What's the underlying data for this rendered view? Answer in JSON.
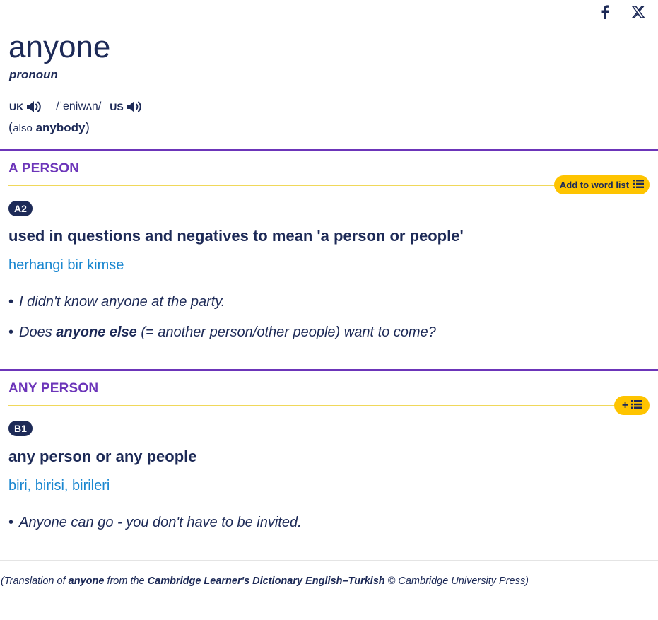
{
  "share": {
    "facebook_icon": "facebook-icon",
    "x_icon": "x-twitter-icon"
  },
  "entry": {
    "headword": "anyone",
    "pos": "pronoun",
    "uk_label": "UK",
    "us_label": "US",
    "ipa": "/ˈeniwʌn/",
    "also_open": "(",
    "also_label": "also",
    "also_word": "anybody",
    "also_close": ")"
  },
  "senses": [
    {
      "guideword": "A PERSON",
      "wordlist_label": "Add to word list",
      "level": "A2",
      "definition": "used in questions and negatives to mean 'a person or people'",
      "translation": "herhangi bir kimse",
      "examples": [
        {
          "bullet": "•",
          "text": "I didn't know anyone at the party."
        },
        {
          "bullet": "•",
          "pre": "Does",
          "bold": "anyone else",
          "post": "(= another person/other people) want to come?"
        }
      ]
    },
    {
      "guideword": "ANY PERSON",
      "wordlist_label": "+",
      "level": "B1",
      "definition": "any person or any people",
      "translation": "biri, birisi, birileri",
      "examples": [
        {
          "bullet": "•",
          "text": "Anyone can go - you don't have to be invited."
        }
      ]
    }
  ],
  "footer": {
    "p1": "(Translation of",
    "word": "anyone",
    "p2": "from the",
    "dict": "Cambridge Learner's Dictionary English–Turkish",
    "p3": "© Cambridge University Press)"
  },
  "colors": {
    "navy": "#1d2a57",
    "purple": "#6c35b9",
    "yellow": "#fec400",
    "link_blue": "#1a87d0"
  }
}
